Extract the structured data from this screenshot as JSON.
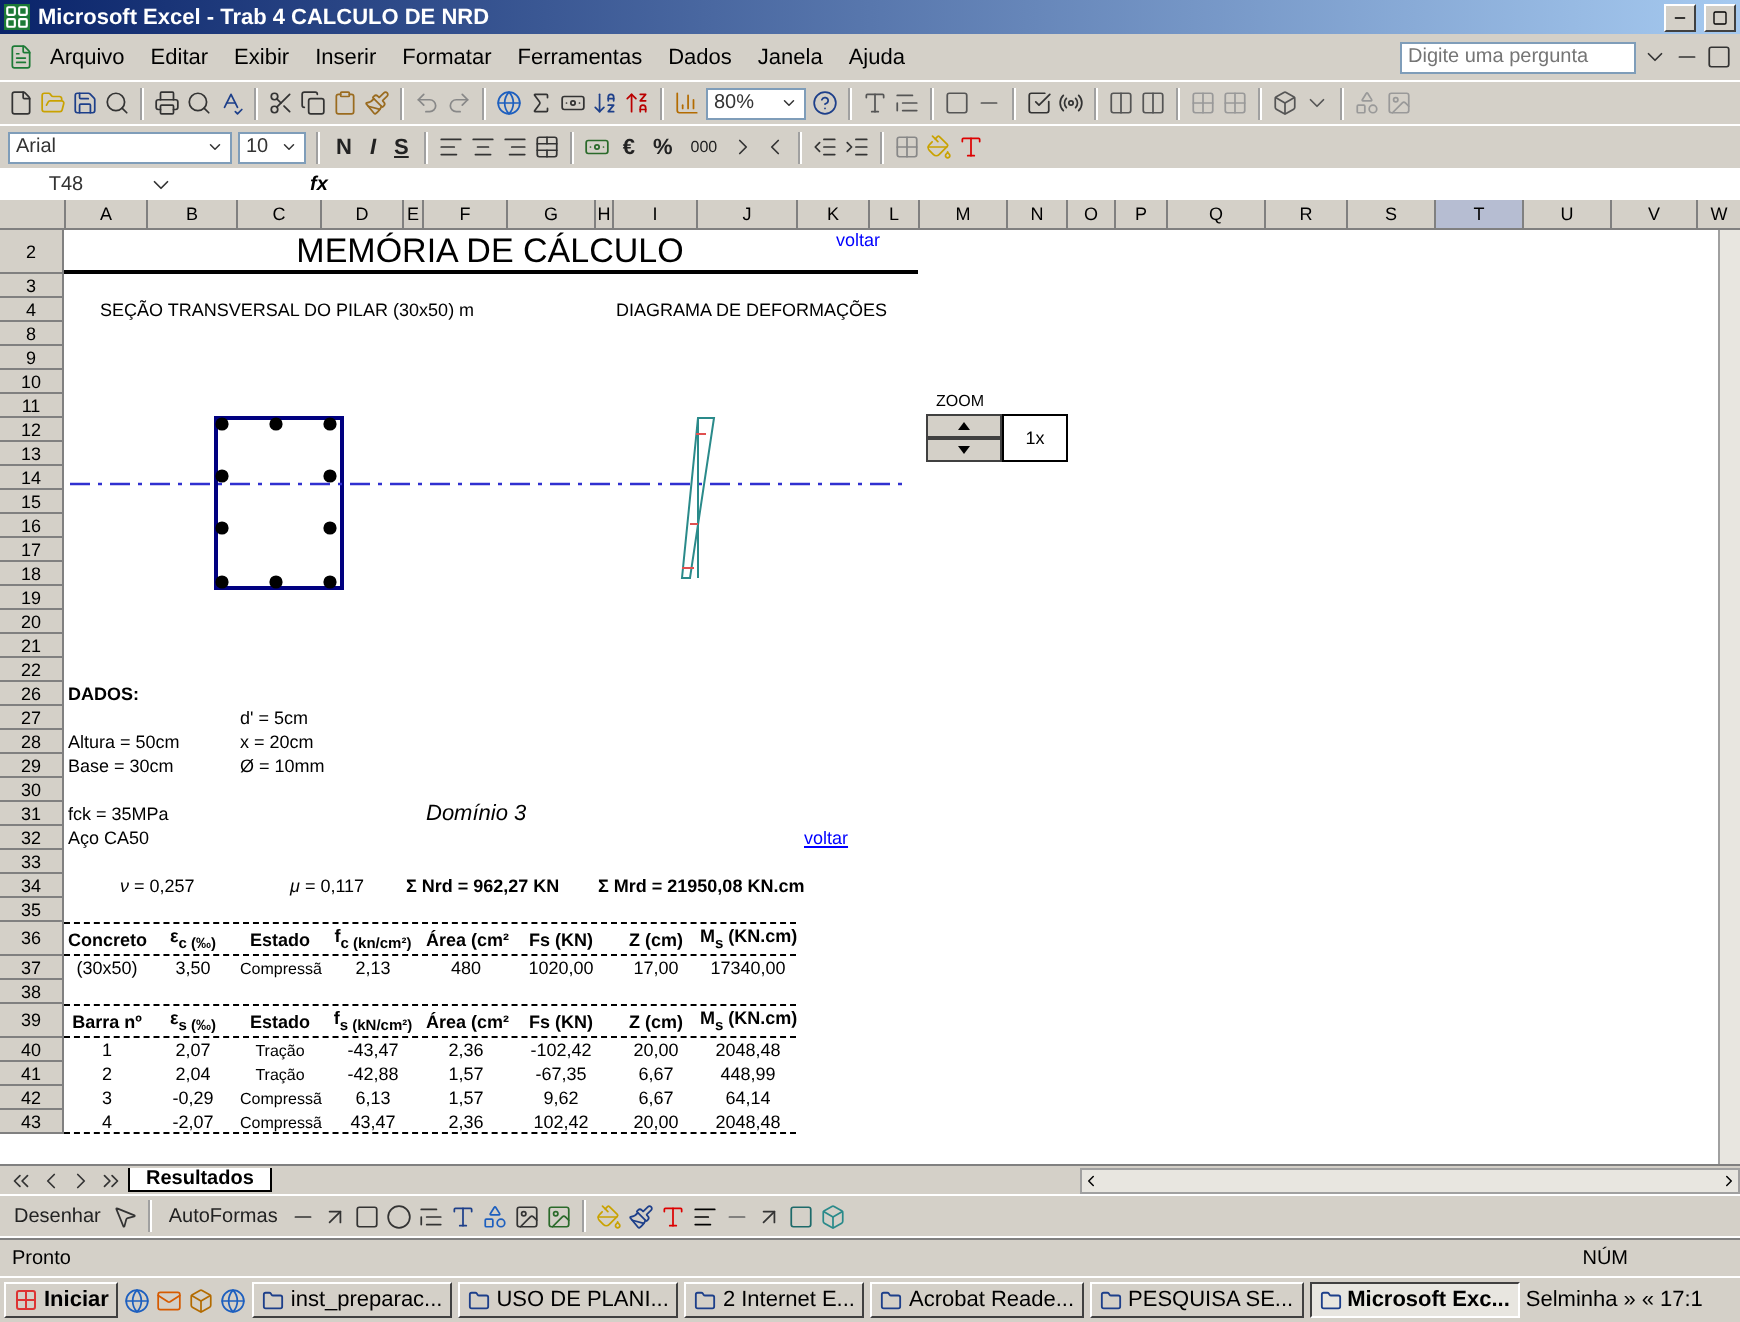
{
  "window": {
    "title": "Microsoft Excel - Trab 4 CALCULO DE NRD"
  },
  "menu": {
    "items": [
      "Arquivo",
      "Editar",
      "Exibir",
      "Inserir",
      "Formatar",
      "Ferramentas",
      "Dados",
      "Janela",
      "Ajuda"
    ],
    "question_placeholder": "Digite uma pergunta"
  },
  "standard_toolbar": {
    "zoom": "80%"
  },
  "formatting_toolbar": {
    "font": "Arial",
    "size": "10",
    "bold": "N",
    "italic": "I",
    "underline": "S",
    "euro": "€",
    "percent": "%",
    "thousands": "000"
  },
  "formula_bar": {
    "name_box": "T48",
    "fx": "fx"
  },
  "columns": [
    {
      "label": "A",
      "selected": false
    },
    {
      "label": "B",
      "selected": false
    },
    {
      "label": "C",
      "selected": false
    },
    {
      "label": "D",
      "selected": false
    },
    {
      "label": "E",
      "selected": false
    },
    {
      "label": "F",
      "selected": false
    },
    {
      "label": "G",
      "selected": false
    },
    {
      "label": "H",
      "selected": false
    },
    {
      "label": "I",
      "selected": false
    },
    {
      "label": "J",
      "selected": false
    },
    {
      "label": "K",
      "selected": false
    },
    {
      "label": "L",
      "selected": false
    },
    {
      "label": "M",
      "selected": false
    },
    {
      "label": "N",
      "selected": false
    },
    {
      "label": "O",
      "selected": false
    },
    {
      "label": "P",
      "selected": false
    },
    {
      "label": "Q",
      "selected": false
    },
    {
      "label": "R",
      "selected": false
    },
    {
      "label": "S",
      "selected": false
    },
    {
      "label": "T",
      "selected": true
    },
    {
      "label": "U",
      "selected": false
    },
    {
      "label": "V",
      "selected": false
    },
    {
      "label": "W",
      "selected": false
    }
  ],
  "rows": [
    {
      "number": "2",
      "kind": "title",
      "cells": [
        "MEMÓRIA DE CÁLCULO",
        "voltar"
      ]
    },
    {
      "number": "3",
      "kind": "empty",
      "cells": []
    },
    {
      "number": "4",
      "kind": "captions",
      "cells": [
        "SEÇÃO TRANSVERSAL DO PILAR (30x50) m",
        "DIAGRAMA DE DEFORMAÇÕES"
      ]
    },
    {
      "number": "8",
      "kind": "empty",
      "cells": []
    },
    {
      "number": "9",
      "kind": "empty",
      "cells": []
    },
    {
      "number": "10",
      "kind": "empty",
      "cells": []
    },
    {
      "number": "11",
      "kind": "empty",
      "cells": []
    },
    {
      "number": "12",
      "kind": "empty",
      "cells": []
    },
    {
      "number": "13",
      "kind": "empty",
      "cells": []
    },
    {
      "number": "14",
      "kind": "empty",
      "cells": []
    },
    {
      "number": "15",
      "kind": "empty",
      "cells": []
    },
    {
      "number": "16",
      "kind": "empty",
      "cells": []
    },
    {
      "number": "17",
      "kind": "empty",
      "cells": []
    },
    {
      "number": "18",
      "kind": "empty",
      "cells": []
    },
    {
      "number": "19",
      "kind": "empty",
      "cells": []
    },
    {
      "number": "20",
      "kind": "empty",
      "cells": []
    },
    {
      "number": "21",
      "kind": "empty",
      "cells": []
    },
    {
      "number": "22",
      "kind": "empty",
      "cells": []
    },
    {
      "number": "26",
      "kind": "heading",
      "cells": [
        "DADOS:"
      ]
    },
    {
      "number": "27",
      "kind": "c_only",
      "cells": [
        "d' = 5cm"
      ]
    },
    {
      "number": "28",
      "kind": "pair",
      "cells": [
        "Altura = 50cm",
        "x = 20cm"
      ]
    },
    {
      "number": "29",
      "kind": "pair",
      "cells": [
        "Base = 30cm",
        "Ø = 10mm"
      ]
    },
    {
      "number": "30",
      "kind": "empty",
      "cells": []
    },
    {
      "number": "31",
      "kind": "domain",
      "cells": [
        "fck = 35MPa",
        "Domínio 3"
      ]
    },
    {
      "number": "32",
      "kind": "link_row",
      "cells": [
        "Aço CA50",
        "voltar"
      ]
    },
    {
      "number": "33",
      "kind": "empty",
      "cells": []
    },
    {
      "number": "34",
      "kind": "results",
      "cells": [
        "*ν* = 0,257",
        "*μ* = 0,117",
        "Σ Nrd = 962,27 KN",
        "Σ Mrd = 21950,08 KN.cm"
      ]
    },
    {
      "number": "35",
      "kind": "empty",
      "cells": []
    },
    {
      "number": "36",
      "kind": "table_head",
      "cells": [
        "Concreto",
        "ε$_{c (‰)}$",
        "Estado",
        "f$_{c (kn/cm²)}$",
        "Área (cm²",
        "Fs (KN)",
        "Z (cm)",
        "M$_{s}$ (KN.cm)"
      ]
    },
    {
      "number": "37",
      "kind": "table_row",
      "cells": [
        "(30x50)",
        "3,50",
        "Compressã",
        "2,13",
        "480",
        "1020,00",
        "17,00",
        "17340,00"
      ]
    },
    {
      "number": "38",
      "kind": "empty",
      "cells": []
    },
    {
      "number": "39",
      "kind": "table_head",
      "cells": [
        "Barra nº",
        "ε$_{s (‰)}$",
        "Estado",
        "f$_{s (kN/cm²)}$",
        "Área (cm²",
        "Fs (KN)",
        "Z (cm)",
        "M$_{s}$ (KN.cm)"
      ]
    },
    {
      "number": "40",
      "kind": "table_row",
      "cells": [
        "1",
        "2,07",
        "Tração",
        "-43,47",
        "2,36",
        "-102,42",
        "20,00",
        "2048,48"
      ]
    },
    {
      "number": "41",
      "kind": "table_row",
      "cells": [
        "2",
        "2,04",
        "Tração",
        "-42,88",
        "1,57",
        "-67,35",
        "6,67",
        "448,99"
      ]
    },
    {
      "number": "42",
      "kind": "table_row",
      "cells": [
        "3",
        "-0,29",
        "Compressã",
        "6,13",
        "1,57",
        "9,62",
        "6,67",
        "64,14"
      ]
    },
    {
      "number": "43",
      "kind": "table_last",
      "cells": [
        "4",
        "-2,07",
        "Compressã",
        "43,47",
        "2,36",
        "102,42",
        "20,00",
        "2048,48"
      ]
    }
  ],
  "zoom_control": {
    "label": "ZOOM",
    "value": "1x"
  },
  "sheet_tabs": [
    {
      "label": "Resultados",
      "selected": true
    }
  ],
  "drawing_toolbar": {
    "draw": "Desenhar",
    "autoshapes": "AutoFormas"
  },
  "status_bar": {
    "status": "Pronto",
    "num": "NÚM"
  },
  "taskbar": {
    "start": "Iniciar",
    "tasks": [
      {
        "label": "inst_preparac...",
        "selected": false
      },
      {
        "label": "USO DE PLANI...",
        "selected": false
      },
      {
        "label": "2 Internet E...",
        "selected": false
      },
      {
        "label": "Acrobat Reade...",
        "selected": false
      },
      {
        "label": "PESQUISA SE...",
        "selected": false
      },
      {
        "label": "Microsoft Exc...",
        "selected": true
      }
    ],
    "user": "Selminha",
    "more": "»",
    "collapse": "«",
    "clock": "17:1"
  }
}
